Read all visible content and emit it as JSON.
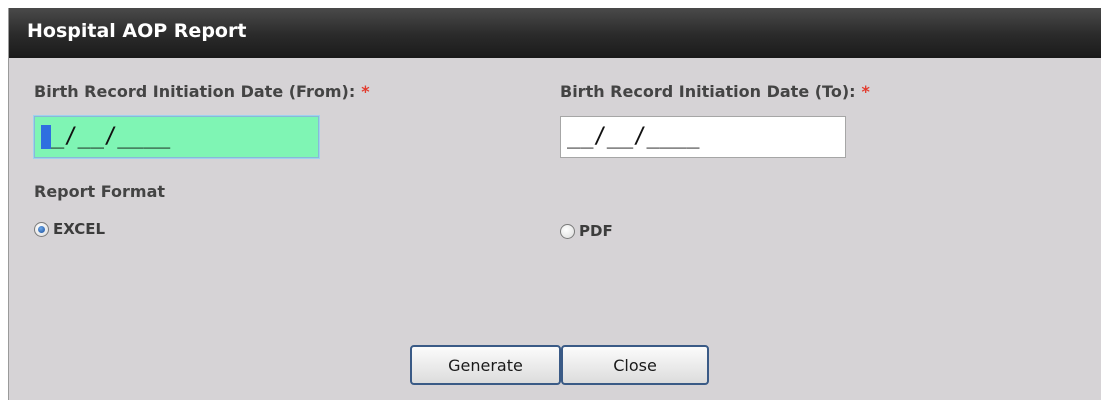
{
  "dialog": {
    "title": "Hospital AOP Report"
  },
  "from_field": {
    "label": "Birth Record Initiation Date (From):",
    "required_marker": "*",
    "mask": "_/__/____",
    "caret_char": "_",
    "state": "focused",
    "background_color": "#7ff5b4"
  },
  "to_field": {
    "label": "Birth Record Initiation Date (To):",
    "required_marker": "*",
    "mask": "__/__/____"
  },
  "report_format": {
    "label": "Report Format",
    "options": [
      {
        "label": "EXCEL",
        "checked": true
      },
      {
        "label": "PDF",
        "checked": false
      }
    ]
  },
  "buttons": {
    "generate_label": "Generate",
    "close_label": "Close"
  },
  "colors": {
    "title_bar": "#2b2b2b",
    "required_star": "#e23b2e",
    "panel_background": "#d6d3d6",
    "button_border": "#3a5a86"
  }
}
